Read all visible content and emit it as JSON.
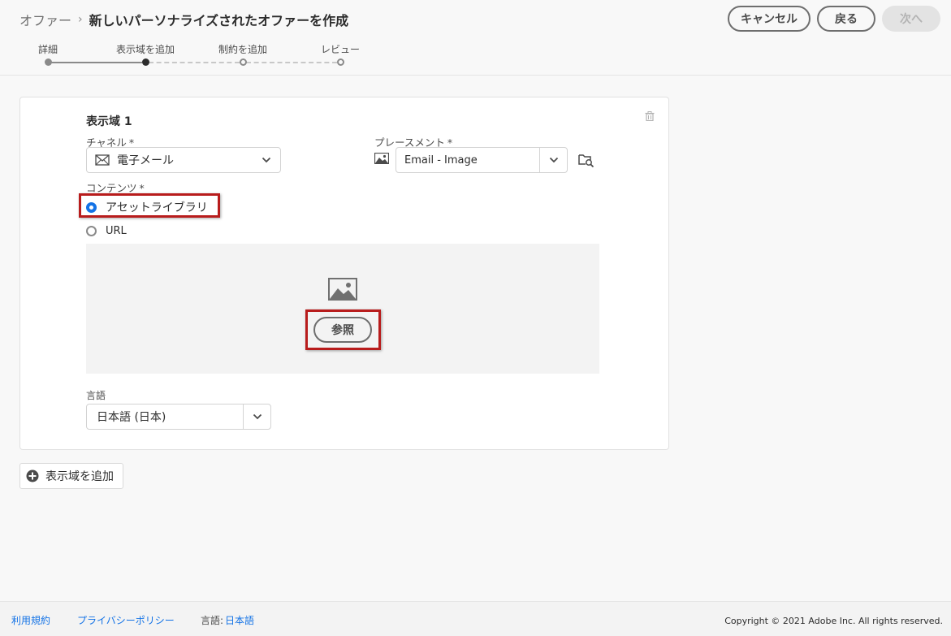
{
  "header": {
    "breadcrumb_parent": "オファー",
    "breadcrumb_sep": "›",
    "title": "新しいパーソナライズされたオファーを作成",
    "buttons": {
      "cancel": "キャンセル",
      "back": "戻る",
      "next": "次へ"
    }
  },
  "stepper": {
    "steps": [
      {
        "label": "詳細",
        "state": "done"
      },
      {
        "label": "表示域を追加",
        "state": "current"
      },
      {
        "label": "制約を追加",
        "state": "future"
      },
      {
        "label": "レビュー",
        "state": "future"
      }
    ]
  },
  "card": {
    "title": "表示域 1",
    "channel": {
      "label": "チャネル",
      "required": "*",
      "value": "電子メール"
    },
    "placement": {
      "label": "プレースメント",
      "required": "*",
      "value": "Email - Image"
    },
    "content": {
      "label": "コンテンツ",
      "required": "*",
      "options": [
        {
          "label": "アセットライブラリ",
          "selected": true
        },
        {
          "label": "URL",
          "selected": false
        }
      ],
      "browse_button": "参照"
    },
    "language": {
      "label": "言語",
      "value": "日本語 (日本)"
    }
  },
  "add_representation": {
    "label": "表示域を追加"
  },
  "footer": {
    "terms": "利用規約",
    "privacy": "プライバシーポリシー",
    "language_label": "言語:",
    "language_value": "日本語",
    "copyright": "Copyright  ©  2021 Adobe Inc.  All rights reserved."
  },
  "colors": {
    "accent": "#1473e6",
    "highlight": "#b81c1c"
  }
}
